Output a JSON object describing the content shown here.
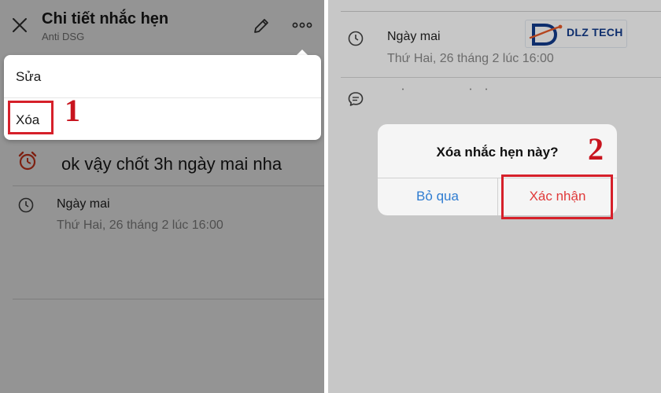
{
  "left_panel": {
    "header": {
      "title": "Chi tiết nhắc hẹn",
      "subtitle": "Anti DSG"
    },
    "reminder": {
      "text": "ok vậy chốt 3h ngày mai nha"
    },
    "time": {
      "main": "Ngày mai",
      "detail": "Thứ Hai, 26 tháng 2 lúc 16:00"
    },
    "menu": {
      "edit_label": "Sửa",
      "delete_label": "Xóa"
    },
    "step_number": "1"
  },
  "right_panel": {
    "time": {
      "main": "Ngày mai",
      "detail": "Thứ Hai, 26 tháng 2 lúc 16:00"
    },
    "logo": {
      "name": "DLZ TECH"
    },
    "dialog": {
      "title": "Xóa nhắc hẹn này?",
      "cancel_label": "Bỏ qua",
      "confirm_label": "Xác nhận"
    },
    "step_number": "2"
  },
  "colors": {
    "highlight_red": "#d6202a",
    "cancel_blue": "#2e7cd1",
    "confirm_red": "#e03a3a",
    "logo_blue": "#123c8c"
  },
  "icons": [
    "close-icon",
    "pencil-icon",
    "more-icon",
    "alarm-clock-icon",
    "clock-icon",
    "chat-icon"
  ]
}
